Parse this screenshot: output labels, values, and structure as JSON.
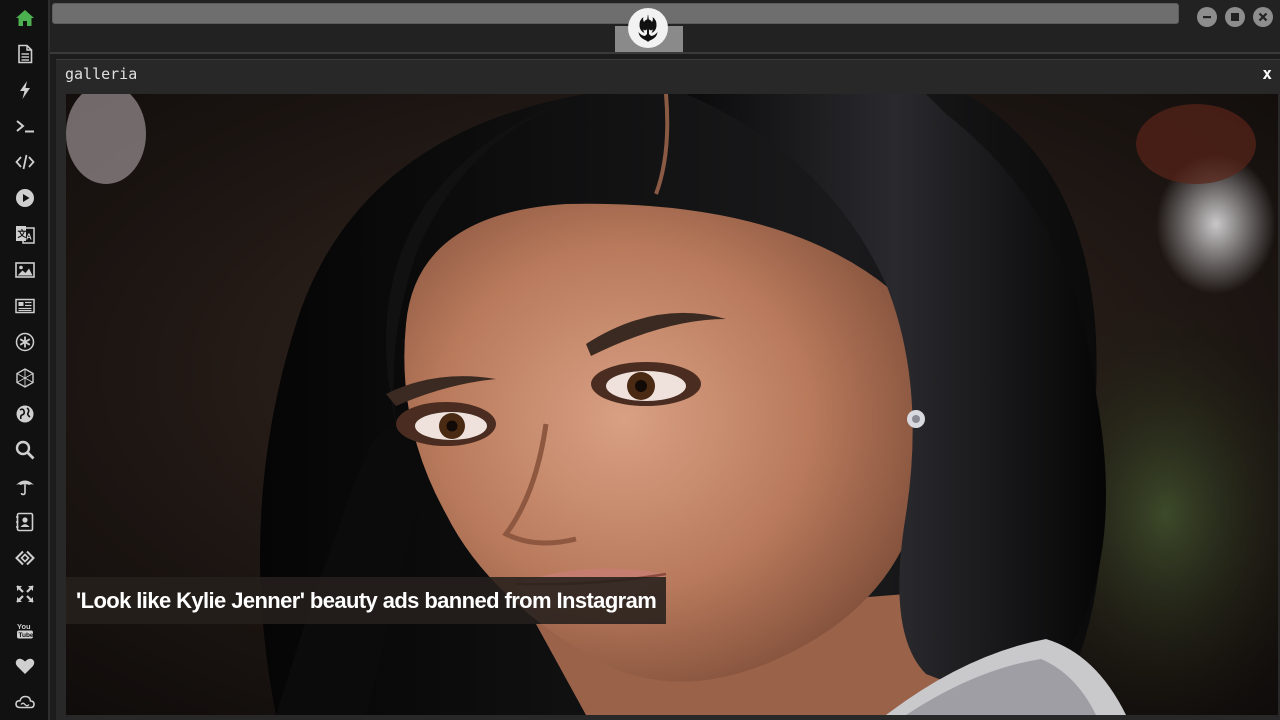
{
  "sidebar": {
    "items": [
      {
        "name": "home-icon",
        "active": true
      },
      {
        "name": "document-icon"
      },
      {
        "name": "lightning-icon"
      },
      {
        "name": "terminal-icon"
      },
      {
        "name": "code-icon"
      },
      {
        "name": "play-icon"
      },
      {
        "name": "translate-icon"
      },
      {
        "name": "image-icon"
      },
      {
        "name": "newspaper-icon"
      },
      {
        "name": "asterisk-icon"
      },
      {
        "name": "hexagon-icon"
      },
      {
        "name": "globe-icon"
      },
      {
        "name": "search-icon"
      },
      {
        "name": "umbrella-icon"
      },
      {
        "name": "contact-card-icon"
      },
      {
        "name": "diamond-code-icon"
      },
      {
        "name": "expand-icon"
      },
      {
        "name": "youtube-icon"
      },
      {
        "name": "heart-icon"
      },
      {
        "name": "cloud-icon"
      }
    ],
    "active_color": "#4caf50",
    "icon_color": "#cfcfcf"
  },
  "topbar": {
    "logo_icon": "rebel-alliance-icon",
    "window_controls": [
      "minimize-icon",
      "maximize-icon",
      "close-icon"
    ]
  },
  "panel": {
    "title": "galleria",
    "close_label": "x",
    "caption": "'Look like Kylie Jenner' beauty ads banned from Instagram"
  }
}
